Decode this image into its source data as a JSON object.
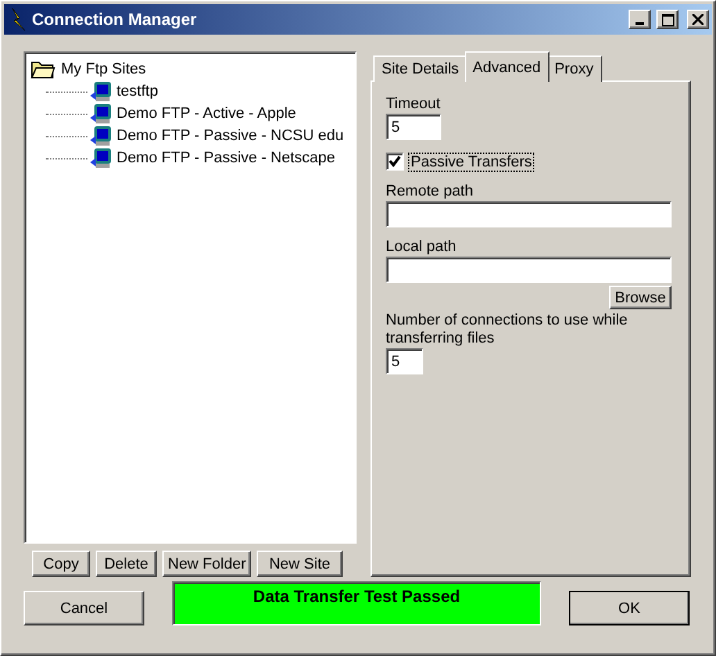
{
  "window": {
    "title": "Connection Manager"
  },
  "tree": {
    "label": "My Ftp Sites",
    "children": [
      {
        "label": "testftp"
      },
      {
        "label": "Demo FTP - Active - Apple"
      },
      {
        "label": "Demo FTP - Passive - NCSU edu"
      },
      {
        "label": "Demo FTP - Passive - Netscape"
      }
    ]
  },
  "tree_buttons": [
    "Copy",
    "Delete",
    "New Folder",
    "New Site"
  ],
  "tabs": [
    {
      "label": "Site Details",
      "selected": false
    },
    {
      "label": "Advanced",
      "selected": true
    },
    {
      "label": "Proxy",
      "selected": false
    }
  ],
  "advanced": {
    "timeout_label": "Timeout",
    "timeout_value": "5",
    "passive": {
      "label": "Passive Transfers",
      "checked": true
    },
    "remote_path_label": "Remote path",
    "local_path_label": "Local path",
    "browse_button": "Browse",
    "connections_label": "Number of connections to use while transferring files",
    "connections_value": "5"
  },
  "cancel_button": "Cancel",
  "status": {
    "text": "Data Transfer Test Passed",
    "passed": true
  },
  "ok_button": "OK"
}
